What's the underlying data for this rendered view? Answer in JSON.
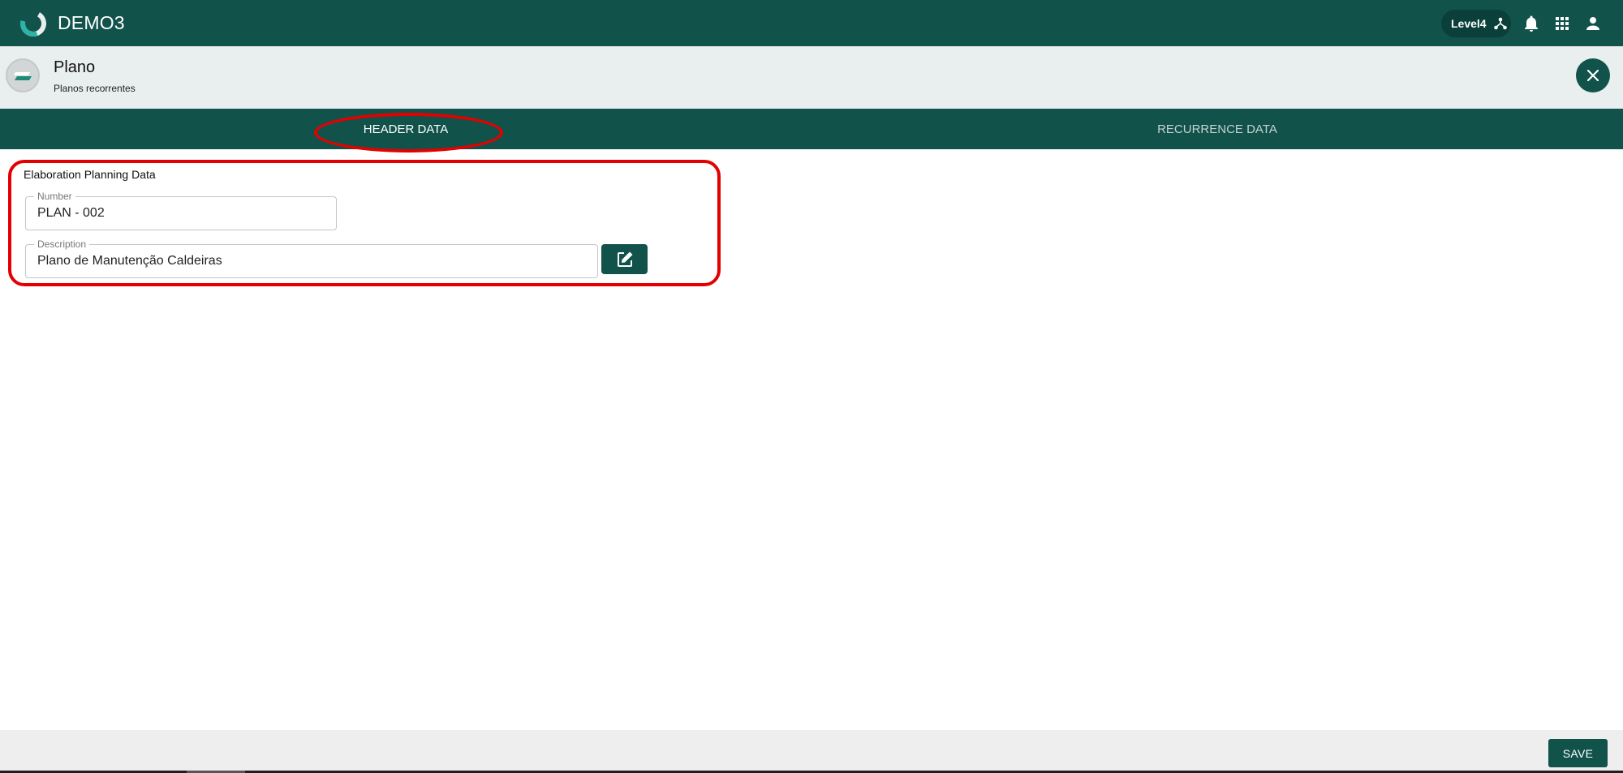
{
  "app": {
    "title": "DEMO3",
    "logo_icon": "ring-logo-icon",
    "level": "Level4",
    "icons": [
      "hierarchy-icon",
      "bell-icon",
      "apps-grid-icon",
      "user-icon"
    ],
    "accent": "#11524b"
  },
  "page": {
    "title": "Plano",
    "subtitle": "Planos recorrentes",
    "close_icon": "close-icon"
  },
  "tabs": [
    {
      "label": "HEADER DATA",
      "active": true
    },
    {
      "label": "RECURRENCE DATA",
      "active": false
    }
  ],
  "form": {
    "section_title": "Elaboration Planning Data",
    "number": {
      "label": "Number",
      "value": "PLAN - 002"
    },
    "description": {
      "label": "Description",
      "value": "Plano de Manutenção Caldeiras"
    },
    "edit_icon": "edit-icon"
  },
  "footer": {
    "save_label": "SAVE"
  },
  "annotation_color": "#e30000"
}
